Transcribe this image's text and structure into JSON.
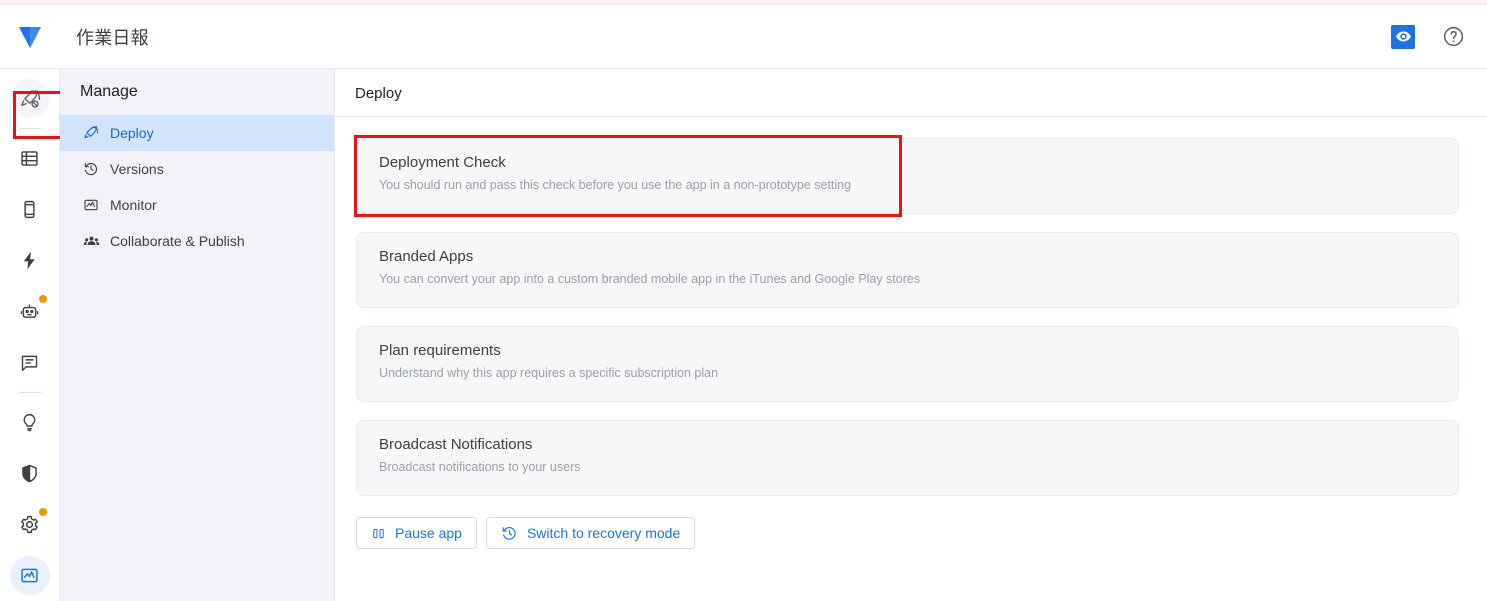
{
  "header": {
    "app_title": "作業日報",
    "logo_name": "appsheet-logo",
    "preview_icon": "eye-icon",
    "help_icon": "help-circle-icon",
    "accent_color": "#1a73e8"
  },
  "rail": {
    "items": [
      {
        "icon": "rocket-icon",
        "name": "rail-item-deploy",
        "active": false,
        "circle": true,
        "badge": false,
        "annotated": true
      },
      {
        "icon": "database-icon",
        "name": "rail-item-data",
        "active": false,
        "circle": false,
        "badge": false,
        "annotated": false
      },
      {
        "icon": "mobile-icon",
        "name": "rail-item-app",
        "active": false,
        "circle": false,
        "badge": false,
        "annotated": false
      },
      {
        "icon": "bolt-icon",
        "name": "rail-item-automation",
        "active": false,
        "circle": false,
        "badge": false,
        "annotated": false
      },
      {
        "icon": "robot-icon",
        "name": "rail-item-intelligence",
        "active": false,
        "circle": false,
        "badge": true,
        "annotated": false
      },
      {
        "icon": "chat-icon",
        "name": "rail-item-chat",
        "active": false,
        "circle": false,
        "badge": false,
        "annotated": false
      },
      {
        "icon": "bulb-icon",
        "name": "rail-item-ideas",
        "active": false,
        "circle": false,
        "badge": false,
        "annotated": false
      },
      {
        "icon": "shield-icon",
        "name": "rail-item-security",
        "active": false,
        "circle": false,
        "badge": false,
        "annotated": false
      },
      {
        "icon": "gear-icon",
        "name": "rail-item-settings",
        "active": false,
        "circle": false,
        "badge": true,
        "annotated": false
      },
      {
        "icon": "monitor-icon",
        "name": "rail-item-monitor",
        "active": true,
        "circle": false,
        "badge": false,
        "annotated": false
      }
    ],
    "badge_color": "#f29900"
  },
  "manage": {
    "title": "Manage",
    "items": [
      {
        "label": "Deploy",
        "icon": "rocket-icon",
        "selected": true
      },
      {
        "label": "Versions",
        "icon": "history-icon",
        "selected": false
      },
      {
        "label": "Monitor",
        "icon": "monitor-icon",
        "selected": false
      },
      {
        "label": "Collaborate & Publish",
        "icon": "people-icon",
        "selected": false
      }
    ],
    "selected_bg": "#d2e3fc",
    "selected_fg": "#1967d2"
  },
  "main": {
    "page_title": "Deploy",
    "cards": [
      {
        "title": "Deployment Check",
        "subtitle": "You should run and pass this check before you use the app in a non-prototype setting",
        "annotated": true
      },
      {
        "title": "Branded Apps",
        "subtitle": "You can convert your app into a custom branded mobile app in the iTunes and Google Play stores",
        "annotated": false
      },
      {
        "title": "Plan requirements",
        "subtitle": "Understand why this app requires a specific subscription plan",
        "annotated": false
      },
      {
        "title": "Broadcast Notifications",
        "subtitle": "Broadcast notifications to your users",
        "annotated": false
      }
    ],
    "actions": [
      {
        "label": "Pause app",
        "icon": "pause-icon",
        "name": "pause-app-button"
      },
      {
        "label": "Switch to recovery mode",
        "icon": "restore-icon",
        "name": "switch-recovery-mode-button"
      }
    ]
  },
  "annotation": {
    "color": "#ee1111"
  }
}
